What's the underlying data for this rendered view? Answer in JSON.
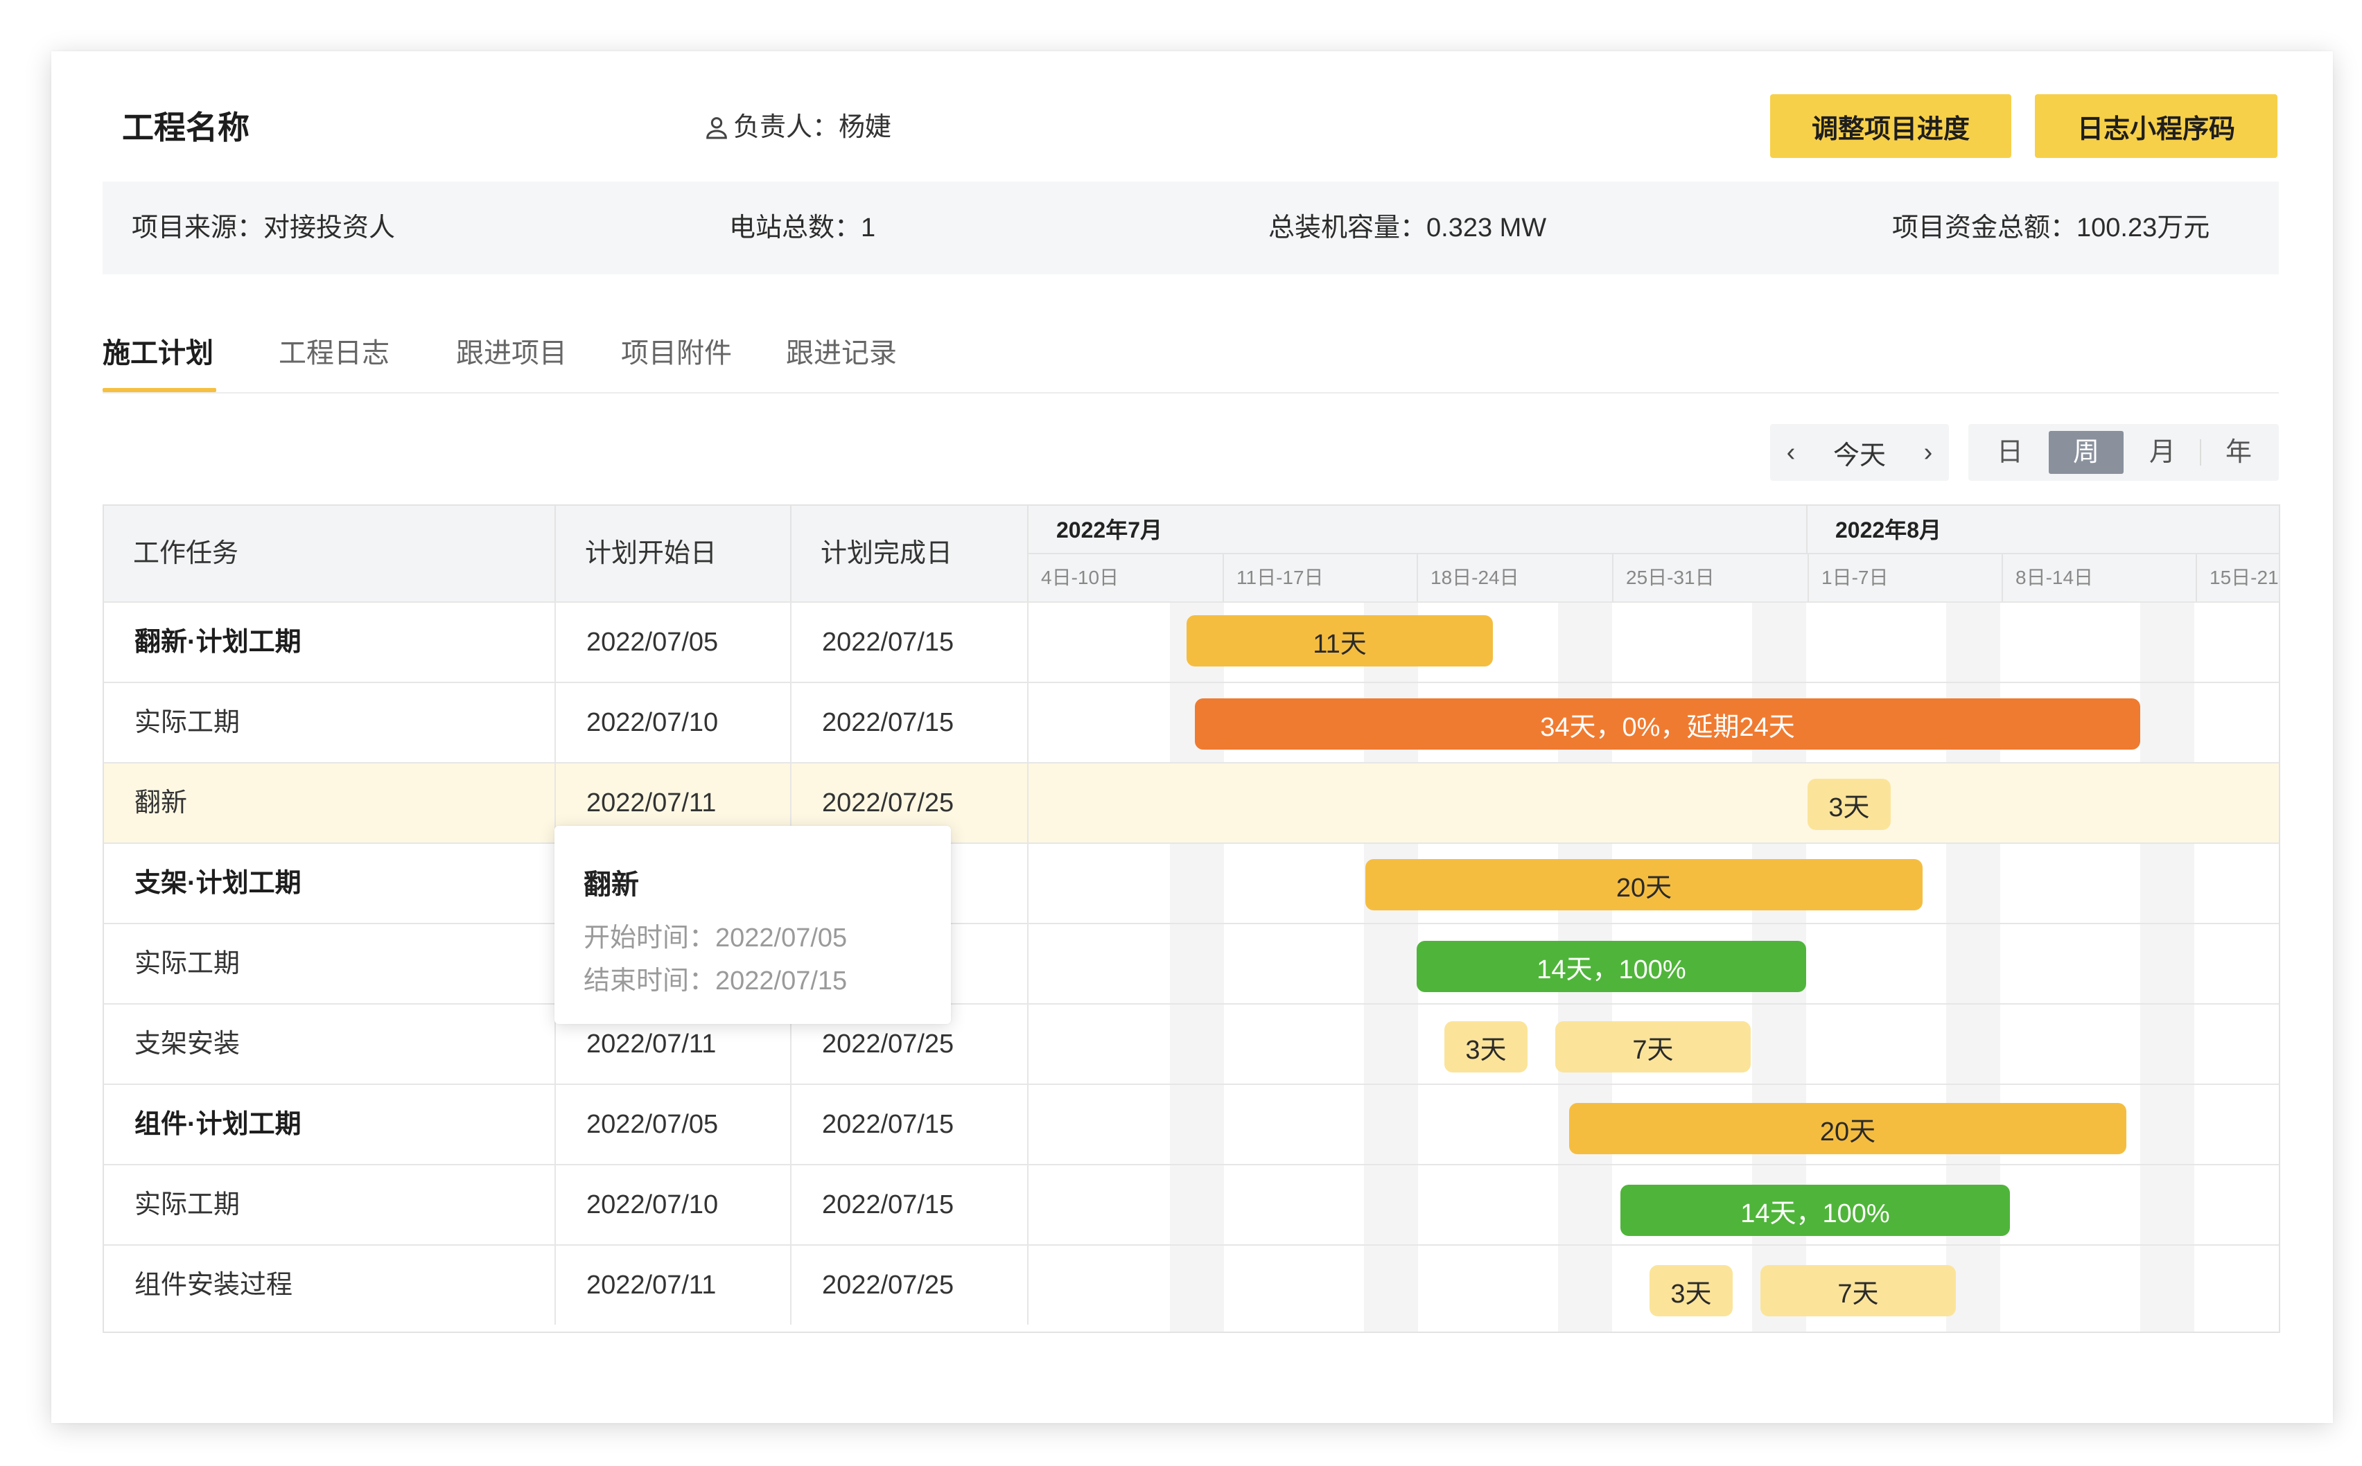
{
  "header": {
    "project_title": "工程名称",
    "manager_label": "负责人：杨婕",
    "adjust_button": "调整项目进度",
    "miniprogram_button": "日志小程序码"
  },
  "info": {
    "source": "项目来源：对接投资人",
    "stations": "电站总数：1",
    "capacity": "总装机容量：0.323 MW",
    "funds": "项目资金总额：100.23万元"
  },
  "tabs": [
    "施工计划",
    "工程日志",
    "跟进项目",
    "项目附件",
    "跟进记录"
  ],
  "active_tab": "施工计划",
  "toolbar": {
    "prev": "‹",
    "today": "今天",
    "next": "›",
    "views": [
      "日",
      "周",
      "月",
      "年"
    ],
    "active_view": "周"
  },
  "table": {
    "headers": {
      "task": "工作任务",
      "start": "计划开始日",
      "end": "计划完成日"
    },
    "months": [
      "2022年7月",
      "2022年8月"
    ],
    "weeks": [
      "4日-10日",
      "11日-17日",
      "18日-24日",
      "25日-31日",
      "1日-7日",
      "8日-14日",
      "15日-21"
    ],
    "rows": [
      {
        "task": "翻新·计划工期",
        "start": "2022/07/05",
        "end": "2022/07/15",
        "bold": true
      },
      {
        "task": "实际工期",
        "start": "2022/07/10",
        "end": "2022/07/15",
        "bold": false
      },
      {
        "task": "翻新",
        "start": "2022/07/11",
        "end": "2022/07/25",
        "bold": false,
        "highlight": true
      },
      {
        "task": "支架·计划工期",
        "start": "",
        "end": "15",
        "bold": true
      },
      {
        "task": "实际工期",
        "start": "",
        "end": "15",
        "bold": false
      },
      {
        "task": "支架安装",
        "start": "2022/07/11",
        "end": "2022/07/25",
        "bold": false
      },
      {
        "task": "组件·计划工期",
        "start": "2022/07/05",
        "end": "2022/07/15",
        "bold": true
      },
      {
        "task": "实际工期",
        "start": "2022/07/10",
        "end": "2022/07/15",
        "bold": false
      },
      {
        "task": "组件安装过程",
        "start": "2022/07/11",
        "end": "2022/07/25",
        "bold": false
      }
    ]
  },
  "bars": [
    {
      "label": "11天",
      "kind": "plan"
    },
    {
      "label": "34天，0%，延期24天",
      "kind": "delay"
    },
    {
      "label": "3天",
      "kind": "seg"
    },
    {
      "label": "20天",
      "kind": "plan"
    },
    {
      "label": "14天，100%",
      "kind": "done"
    },
    {
      "label": "3天",
      "kind": "seg"
    },
    {
      "label": "7天",
      "kind": "seg"
    },
    {
      "label": "20天",
      "kind": "plan"
    },
    {
      "label": "14天，100%",
      "kind": "done"
    },
    {
      "label": "3天",
      "kind": "seg"
    },
    {
      "label": "7天",
      "kind": "seg"
    }
  ],
  "tooltip": {
    "title": "翻新",
    "start_line": "开始时间：2022/07/05",
    "end_line": "结束时间：2022/07/15"
  },
  "colors": {
    "accent_yellow": "#f7d04a",
    "plan_bar": "#f5bd40",
    "delay_bar": "#ef7b31",
    "done_bar": "#4fb53a",
    "segment_bar": "#fbe49a",
    "highlight_row": "#fef8e3",
    "active_view": "#8a919d"
  }
}
